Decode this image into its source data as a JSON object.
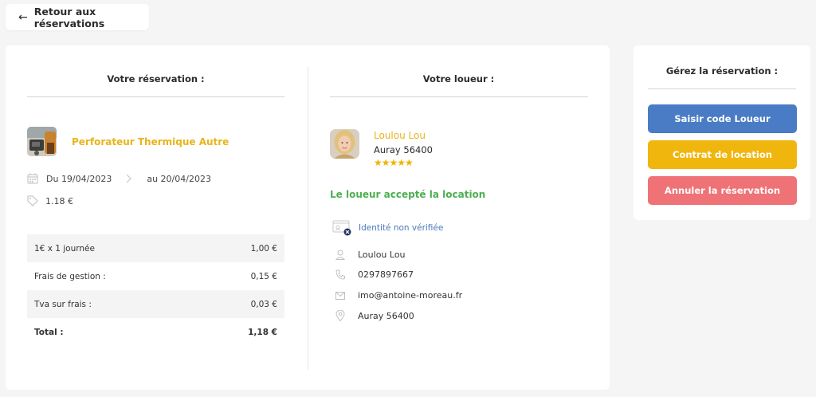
{
  "nav": {
    "back_label": "Retour aux réservations"
  },
  "reservation": {
    "title": "Votre réservation :",
    "product_name": "Perforateur Thermique Autre",
    "date_from": "Du 19/04/2023",
    "date_to": "au 20/04/2023",
    "price": "1.18 €",
    "fees": [
      {
        "label": "1€ x 1 journée",
        "value": "1,00 €"
      },
      {
        "label": "Frais de gestion :",
        "value": "0,15 €"
      },
      {
        "label": "Tva sur frais :",
        "value": "0,03 €"
      },
      {
        "label": "Total :",
        "value": "1,18 €"
      }
    ]
  },
  "owner": {
    "title": "Votre loueur :",
    "name": "Loulou Lou",
    "city": "Auray 56400",
    "rating": 5,
    "stars": "★★★★★",
    "status": "Le loueur accepté la location",
    "identity": "Identité non vérifiée",
    "contact_name": "Loulou Lou",
    "phone": "0297897667",
    "email": "imo@antoine-moreau.fr",
    "address": "Auray 56400"
  },
  "manage": {
    "title": "Gérez la réservation :",
    "buttons": [
      {
        "label": "Saisir code Loueur",
        "color": "#4a7cc6"
      },
      {
        "label": "Contrat de location",
        "color": "#f0b60e"
      },
      {
        "label": "Annuler la réservation",
        "color": "#ef7276"
      }
    ]
  },
  "colors": {
    "accent_yellow": "#e8b41a",
    "success_green": "#4caf50",
    "link_blue": "#4a78b8"
  }
}
